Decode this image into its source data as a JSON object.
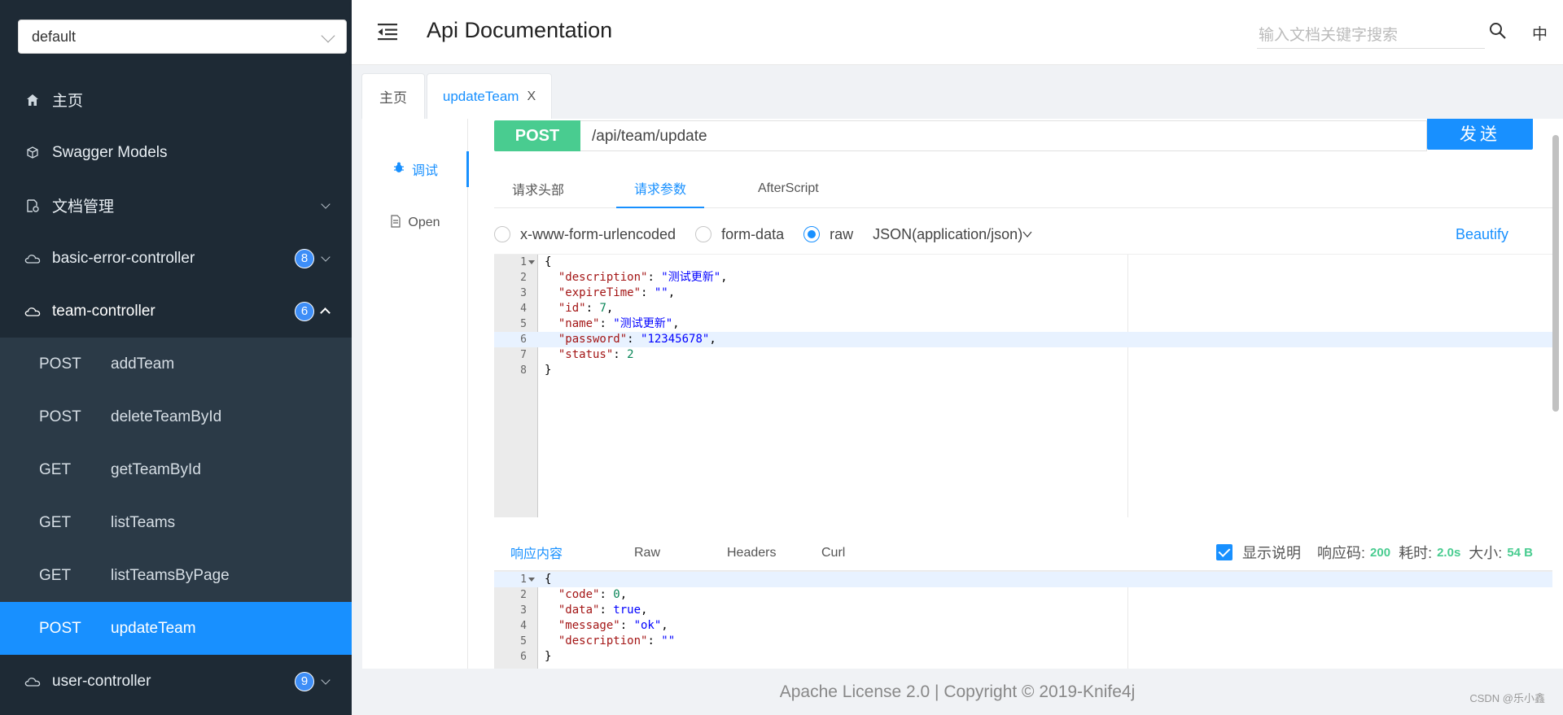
{
  "sidebar": {
    "group_select": "default",
    "items": [
      {
        "label": "主页",
        "icon": "home-icon"
      },
      {
        "label": "Swagger Models",
        "icon": "cube-icon"
      },
      {
        "label": "文档管理",
        "icon": "document-settings-icon"
      },
      {
        "label": "basic-error-controller",
        "icon": "cloud-icon",
        "badge": "8"
      },
      {
        "label": "team-controller",
        "icon": "cloud-icon",
        "badge": "6"
      },
      {
        "label": "user-controller",
        "icon": "cloud-icon",
        "badge": "9"
      }
    ],
    "team_endpoints": [
      {
        "method": "POST",
        "name": "addTeam"
      },
      {
        "method": "POST",
        "name": "deleteTeamById"
      },
      {
        "method": "GET",
        "name": "getTeamById"
      },
      {
        "method": "GET",
        "name": "listTeams"
      },
      {
        "method": "GET",
        "name": "listTeamsByPage"
      },
      {
        "method": "POST",
        "name": "updateTeam"
      }
    ]
  },
  "header": {
    "title": "Api Documentation",
    "search_placeholder": "输入文档关键字搜索",
    "lang": "中"
  },
  "tabs": [
    {
      "label": "主页"
    },
    {
      "label": "updateTeam",
      "close": "X"
    }
  ],
  "side_tabs": [
    {
      "label": "调试"
    },
    {
      "label": "Open"
    }
  ],
  "request": {
    "method": "POST",
    "url": "/api/team/update",
    "send_label": "发送",
    "tabs": [
      "请求头部",
      "请求参数",
      "AfterScript"
    ],
    "body_types": [
      "x-www-form-urlencoded",
      "form-data",
      "raw"
    ],
    "content_type": "JSON(application/json)",
    "beautify": "Beautify",
    "body_lines": [
      "1",
      "2",
      "3",
      "4",
      "5",
      "6",
      "7",
      "8"
    ]
  },
  "response": {
    "tabs": [
      "响应内容",
      "Raw",
      "Headers",
      "Curl"
    ],
    "show_desc_label": "显示说明",
    "status_label": "响应码:",
    "status": "200",
    "time_label": "耗时:",
    "time": "2.0s",
    "size_label": "大小:",
    "size": "54 B",
    "body_lines": [
      "1",
      "2",
      "3",
      "4",
      "5",
      "6"
    ]
  },
  "footer": {
    "text": "Apache License 2.0 | Copyright © 2019-Knife4j",
    "watermark": "CSDN @乐小鑫"
  },
  "colors": {
    "sidebar_bg": "#1e2a35",
    "accent": "#1890ff",
    "post_green": "#49cc90"
  }
}
